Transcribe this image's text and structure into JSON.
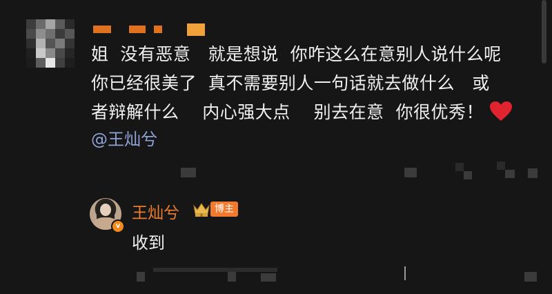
{
  "comment": {
    "lines": [
      "姐  没有恶意   就是想说  你咋这么在意别人说什么呢",
      "你已经很美了  真不需要别人一句话就去做什么   或",
      "者辩解什么    内心强大点    别去在意  你很优秀！"
    ],
    "mention": "@王灿兮",
    "heart_icon": "heart-icon"
  },
  "reply": {
    "name": "王灿兮",
    "badge": "博主",
    "text": "收到",
    "accent_color": "#ef7d2c"
  },
  "colors": {
    "background": "#161616",
    "text": "#f0f0f0",
    "mention": "#8ea3d6",
    "heart": "#e0242f"
  }
}
